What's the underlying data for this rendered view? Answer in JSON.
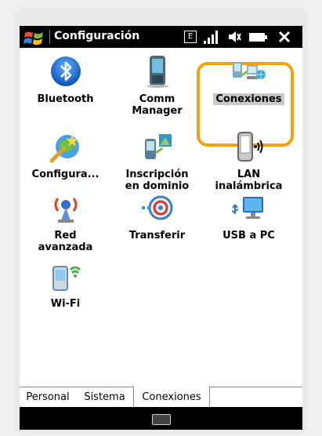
{
  "titlebar": {
    "title": "Configuración",
    "status_box": "E"
  },
  "items": [
    {
      "id": "bluetooth",
      "label": "Bluetooth",
      "icon": "bluetooth-icon"
    },
    {
      "id": "comm-manager",
      "label": "Comm\nManager",
      "icon": "comm-manager-icon"
    },
    {
      "id": "conexiones",
      "label": "Conexiones",
      "icon": "connections-icon",
      "selected": true
    },
    {
      "id": "configura",
      "label": "Configura...",
      "icon": "configure-icon"
    },
    {
      "id": "inscripcion",
      "label": "Inscripción\nen dominio",
      "icon": "domain-enrollment-icon"
    },
    {
      "id": "lan",
      "label": "LAN\ninalámbrica",
      "icon": "wireless-lan-icon"
    },
    {
      "id": "red-avanzada",
      "label": "Red\navanzada",
      "icon": "advanced-network-icon"
    },
    {
      "id": "transferir",
      "label": "Transferir",
      "icon": "beam-icon"
    },
    {
      "id": "usb",
      "label": "USB a PC",
      "icon": "usb-to-pc-icon"
    },
    {
      "id": "wifi",
      "label": "Wi-Fi",
      "icon": "wifi-icon"
    }
  ],
  "tabs": [
    {
      "label": "Personal",
      "active": false
    },
    {
      "label": "Sistema",
      "active": false
    },
    {
      "label": "Conexiones",
      "active": true
    }
  ],
  "colors": {
    "highlight": "#f2a20a",
    "titlebar": "#000000"
  }
}
